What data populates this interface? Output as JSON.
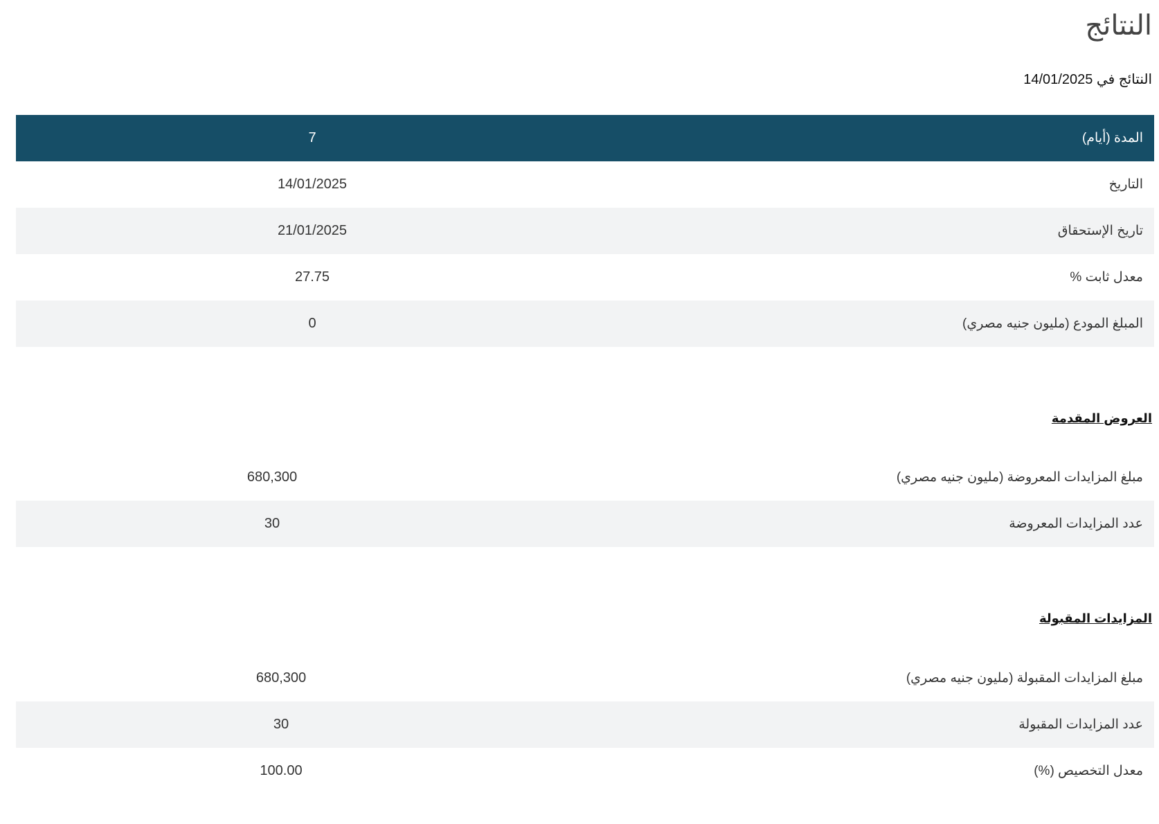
{
  "page": {
    "title": "النتائج",
    "results_date_label": "النتائج في",
    "results_date": "14/01/2025"
  },
  "summary_table": {
    "header": {
      "label": "المدة (أيام)",
      "value": "7"
    },
    "rows": [
      {
        "label": "التاريخ",
        "value": "14/01/2025"
      },
      {
        "label": "تاريخ الإستحقاق",
        "value": "21/01/2025"
      },
      {
        "label": "معدل ثابت %",
        "value": "27.75"
      },
      {
        "label": "المبلغ المودع (مليون جنيه مصري)",
        "value": "0"
      }
    ]
  },
  "offers_section": {
    "heading": "العروض المقدمة",
    "rows": [
      {
        "label": "مبلغ المزايدات المعروضة (مليون جنيه مصري)",
        "value": "680,300"
      },
      {
        "label": "عدد المزايدات المعروضة",
        "value": "30"
      }
    ]
  },
  "accepted_section": {
    "heading": "المزايدات المقبولة",
    "rows": [
      {
        "label": "مبلغ المزايدات المقبولة (مليون جنيه مصري)",
        "value": "680,300"
      },
      {
        "label": "عدد المزايدات المقبولة",
        "value": "30"
      },
      {
        "label": "معدل التخصيص (%)",
        "value": "100.00"
      }
    ]
  }
}
